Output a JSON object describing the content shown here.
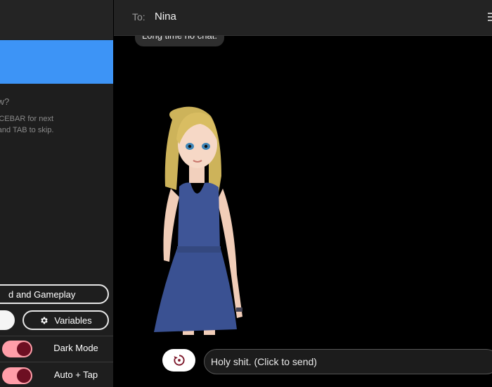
{
  "header": {
    "to_label": "To:",
    "recipient": "Nina"
  },
  "chat": {
    "last_message": "Long time no chat."
  },
  "sidebar": {
    "hint_title": "Did you know?",
    "hint_text": "Press SPACEBAR for next message, and TAB to skip.",
    "gameplay_button": "d and Gameplay",
    "variables_button": "Variables",
    "toggles": [
      {
        "label": "Dark Mode",
        "on": true
      },
      {
        "label": "Auto + Tap",
        "on": true
      }
    ]
  },
  "composer": {
    "reply_text": "Holy shit. (Click to send)"
  },
  "colors": {
    "accent_blue": "#3d94f6",
    "toggle_track": "#ff9ea9",
    "toggle_knob": "#6d0f22"
  }
}
